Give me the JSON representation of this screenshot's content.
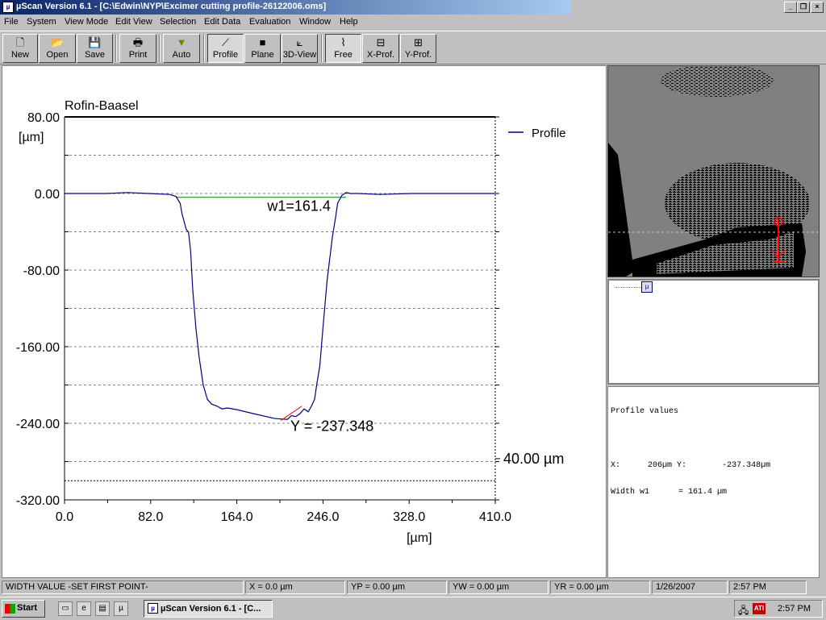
{
  "window": {
    "title": "µScan Version 6.1 - [C:\\Edwin\\NYP\\Excimer cutting profile-26122006.oms]",
    "app_icon": "µ"
  },
  "menu": [
    "File",
    "System",
    "View Mode",
    "Edit View",
    "Selection",
    "Edit Data",
    "Evaluation",
    "Window",
    "Help"
  ],
  "toolbar": {
    "new": "New",
    "open": "Open",
    "save": "Save",
    "print": "Print",
    "auto": "Auto",
    "profile": "Profile",
    "plane": "Plane",
    "view3d": "3D-View",
    "free": "Free",
    "xprof": "X-Prof.",
    "yprof": "Y-Prof."
  },
  "chart_data": {
    "type": "line",
    "title": "Rofin-Baasel",
    "xlabel": "[µm]",
    "ylabel": "[µm]",
    "xlim": [
      0,
      410
    ],
    "ylim": [
      -320,
      80
    ],
    "xticks": [
      "0.0",
      "82.0",
      "164.0",
      "246.0",
      "328.0",
      "410.0"
    ],
    "yticks": [
      "80.00",
      "0.00",
      "-80.00",
      "-160.00",
      "-240.00",
      "-320.00"
    ],
    "legend": [
      "Profile"
    ],
    "grid": true,
    "series": [
      {
        "name": "Profile",
        "color": "#00007f",
        "x": [
          0,
          40,
          60,
          80,
          100,
          106,
          110,
          112,
          116,
          118,
          120,
          122,
          125,
          128,
          132,
          136,
          140,
          145,
          150,
          155,
          165,
          180,
          200,
          212,
          216,
          220,
          224,
          228,
          232,
          235,
          238,
          240,
          243,
          246,
          250,
          255,
          258,
          260,
          264,
          268,
          272,
          280,
          300,
          330,
          380,
          410
        ],
        "y": [
          0,
          0,
          1,
          0,
          -1,
          -3,
          -10,
          -22,
          -38,
          -40,
          -60,
          -100,
          -140,
          -170,
          -200,
          -215,
          -220,
          -222,
          -225,
          -224,
          -226,
          -230,
          -235,
          -236,
          -232,
          -233,
          -230,
          -225,
          -228,
          -222,
          -215,
          -200,
          -180,
          -140,
          -90,
          -45,
          -25,
          -10,
          -2,
          1,
          0,
          0,
          -1,
          0,
          0,
          0
        ]
      }
    ],
    "annotations": [
      {
        "text": "w1=161.4",
        "x": 193,
        "y": -18
      },
      {
        "text": "Y = -237.348",
        "x": 215,
        "y": -248
      },
      {
        "text": "40.00 µm",
        "x": 410,
        "y": -282
      }
    ],
    "width_line": {
      "x": [
        106,
        268
      ],
      "y": -4,
      "color": "#008000"
    }
  },
  "profile_values": {
    "title": "Profile values",
    "x_label": "X:",
    "x_value": "206µm",
    "y_label": "Y:",
    "y_value": "-237.348µm",
    "width_label": "Width w1",
    "width_value": "= 161.4 µm"
  },
  "status": {
    "message": "WIDTH VALUE -SET FIRST POINT-",
    "x": "X = 0.0 µm",
    "yp": "YP = 0.00 µm",
    "yw": "YW = 0.00 µm",
    "yr": "YR = 0.00 µm",
    "date": "1/26/2007",
    "time": "2:57 PM"
  },
  "taskbar": {
    "start": "Start",
    "task": "µScan Version 6.1 - [C...",
    "clock": "2:57 PM"
  },
  "colors": {
    "title_start": "#0a246a",
    "title_end": "#a6caf0",
    "series": "#00007f",
    "marker_red": "#ff0000"
  }
}
